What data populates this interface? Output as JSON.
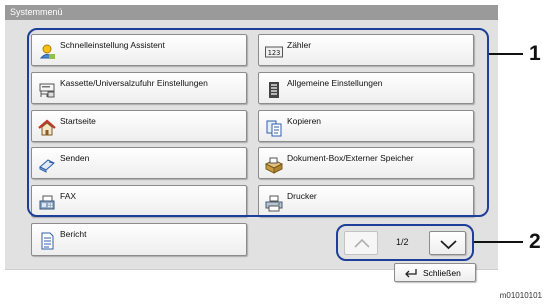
{
  "window": {
    "title": "Systemmenü"
  },
  "menu": {
    "left": [
      {
        "label": "Schnelleinstellung Assistent",
        "icon": "wizard-icon"
      },
      {
        "label": "Kassette/Universalzufuhr Einstellungen",
        "icon": "cassette-icon"
      },
      {
        "label": "Startseite",
        "icon": "home-icon"
      },
      {
        "label": "Senden",
        "icon": "send-icon"
      },
      {
        "label": "FAX",
        "icon": "fax-icon"
      },
      {
        "label": "Bericht",
        "icon": "report-icon"
      }
    ],
    "right": [
      {
        "label": "Zähler",
        "icon": "counter-icon"
      },
      {
        "label": "Allgemeine Einstellungen",
        "icon": "general-settings-icon"
      },
      {
        "label": "Kopieren",
        "icon": "copy-icon"
      },
      {
        "label": "Dokument-Box/Externer Speicher",
        "icon": "document-box-icon"
      },
      {
        "label": "Drucker",
        "icon": "printer-icon"
      }
    ]
  },
  "pagination": {
    "indicator": "1/2",
    "up_enabled": false,
    "down_enabled": true
  },
  "close": {
    "label": "Schließen",
    "icon": "enter-return-icon"
  },
  "callouts": {
    "one": "1",
    "two": "2"
  },
  "figure_id": "m01010101",
  "colors": {
    "outline": "#1d3f9a",
    "titlebar": "#9a9a9a",
    "panel": "#e1e1e1"
  }
}
